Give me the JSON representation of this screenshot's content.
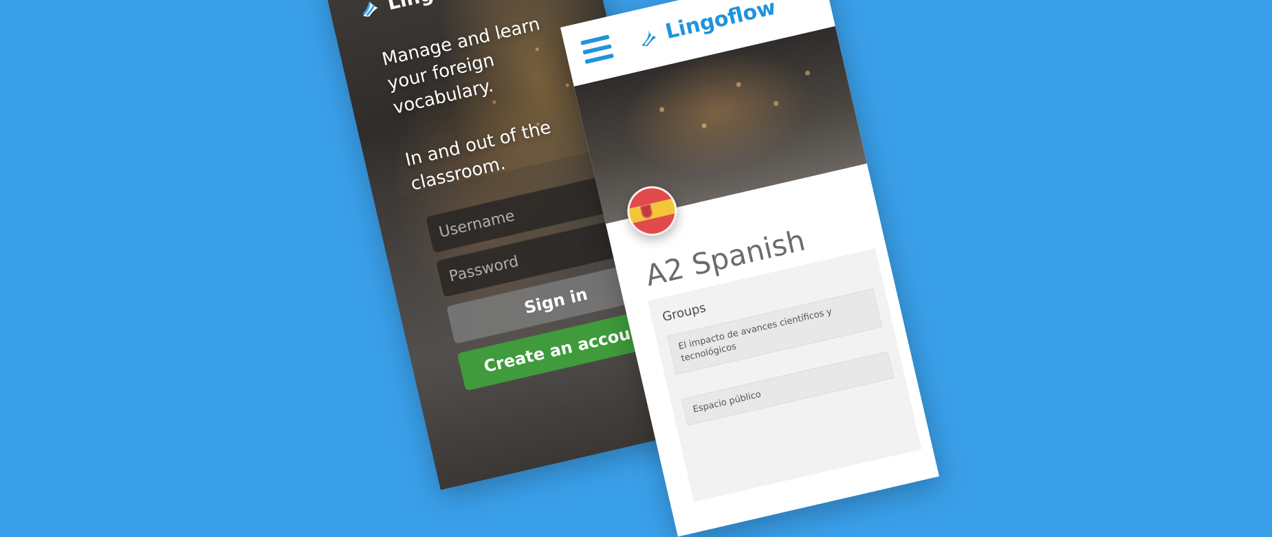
{
  "login_screen": {
    "brand_name": "Lingoflow",
    "tagline_1": "Manage and learn your foreign vocabulary.",
    "tagline_2": "In and out of the classroom.",
    "username_placeholder": "Username",
    "password_placeholder": "Password",
    "sign_in_label": "Sign in",
    "create_account_label": "Create an account",
    "colors": {
      "create_account": "#3f9b3b",
      "sign_in": "#787878"
    }
  },
  "course_screen": {
    "brand_name": "Lingoflow",
    "menu_icon": "menu-icon",
    "course_title": "A2 Spanish",
    "groups_label": "Groups",
    "groups": [
      "El impacto de avances científicos y tecnológicos",
      "Espacio público"
    ],
    "colors": {
      "brand": "#1f93dc",
      "background": "#3a9fe9"
    }
  }
}
